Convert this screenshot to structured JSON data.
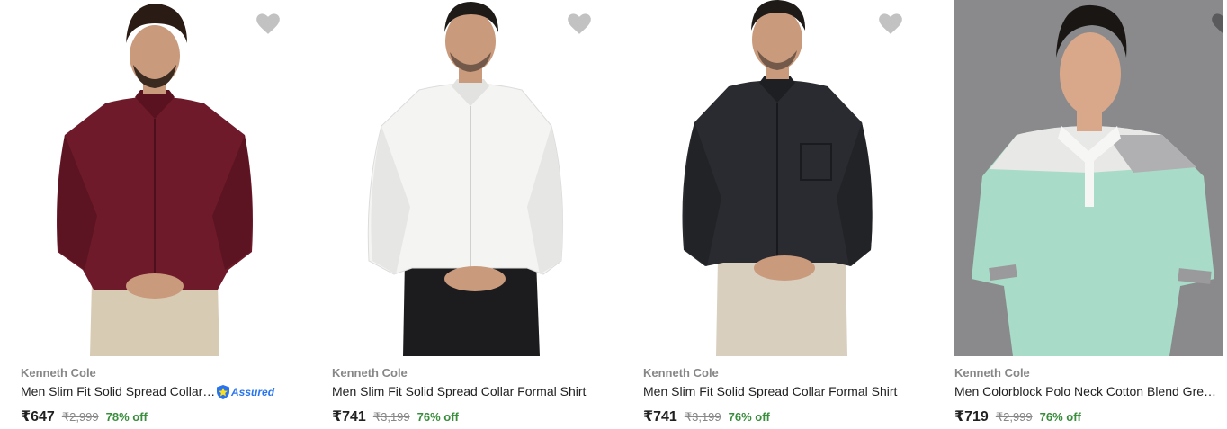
{
  "products": [
    {
      "brand": "Kenneth Cole",
      "title": "Men Slim Fit Solid Spread Collar Formal Shirt",
      "price": "₹647",
      "mrp": "₹2,999",
      "discount": "78% off",
      "assured": true,
      "assured_label": "Assured",
      "shirt_color": "#6e1a2a",
      "wishlist_icon": "heart-icon"
    },
    {
      "brand": "Kenneth Cole",
      "title": "Men Slim Fit Solid Spread Collar Formal Shirt",
      "price": "₹741",
      "mrp": "₹3,199",
      "discount": "76% off",
      "shirt_color": "#f4f4f2",
      "wishlist_icon": "heart-icon"
    },
    {
      "brand": "Kenneth Cole",
      "title": "Men Slim Fit Solid Spread Collar Formal Shirt",
      "price": "₹741",
      "mrp": "₹3,199",
      "discount": "76% off",
      "shirt_color": "#2a2b30",
      "wishlist_icon": "heart-icon"
    },
    {
      "brand": "Kenneth Cole",
      "title": "Men Colorblock Polo Neck Cotton Blend Green T-Shirt",
      "price": "₹719",
      "mrp": "₹2,999",
      "discount": "76% off",
      "shirt_color": "#a8dcc8",
      "wishlist_icon": "heart-icon"
    }
  ],
  "colors": {
    "brand_text": "#878787",
    "discount": "#388e3c",
    "assured": "#2874f0",
    "wishlist": "#c2c2c2"
  }
}
